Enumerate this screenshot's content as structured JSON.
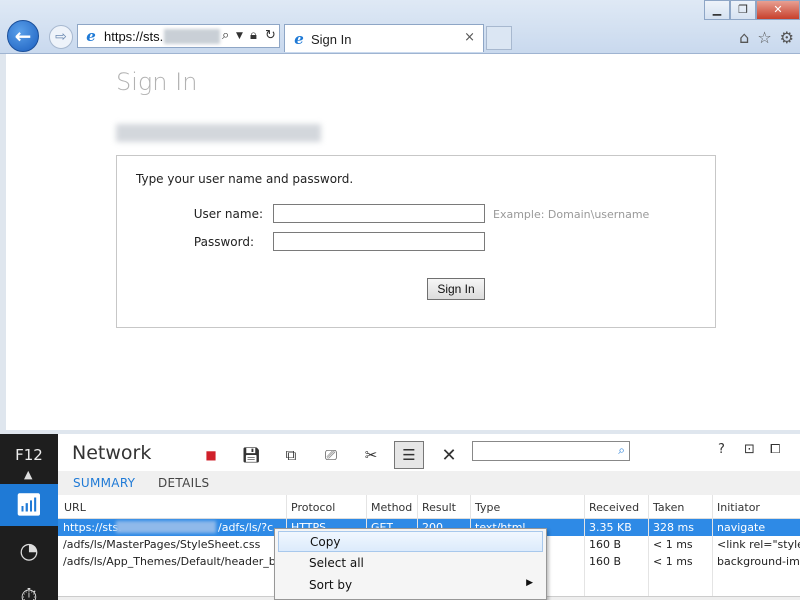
{
  "browser": {
    "address_prefix": "https://sts.",
    "tab_title": "Sign In",
    "tab_close": "×"
  },
  "page": {
    "title": "Sign In",
    "intro": "Type your user name and password.",
    "username_label": "User name:",
    "username_hint": "Example: Domain\\username",
    "password_label": "Password:",
    "signin_button": "Sign In"
  },
  "devtools": {
    "f12_label": "F12",
    "panel_title": "Network",
    "tabs": [
      "SUMMARY",
      "DETAILS"
    ],
    "columns": [
      "URL",
      "Protocol",
      "Method",
      "Result",
      "Type",
      "Received",
      "Taken",
      "Initiator"
    ],
    "rows": [
      {
        "url": "https://sts.",
        "url_tail": "/adfs/ls/?c...",
        "protocol": "HTTPS",
        "method": "GET",
        "result": "200",
        "type": "text/html",
        "received": "3.35 KB",
        "taken": "328 ms",
        "initiator": "navigate"
      },
      {
        "url": "/adfs/ls/MasterPages/StyleSheet.css",
        "url_tail": "",
        "protocol": "",
        "method": "",
        "result": "",
        "type": "",
        "received": "160 B",
        "taken": "< 1 ms",
        "initiator": "<link rel=\"style..."
      },
      {
        "url": "/adfs/ls/App_Themes/Default/header_bac...",
        "url_tail": "",
        "protocol": "",
        "method": "",
        "result": "",
        "type": "",
        "received": "160 B",
        "taken": "< 1 ms",
        "initiator": "background-imag"
      }
    ],
    "help": "?"
  },
  "context_menu": {
    "items": [
      "Copy",
      "Select all",
      "Sort by"
    ]
  },
  "colors": {
    "accent": "#1f7ad6",
    "selection": "#2e8ae6",
    "record": "#d0202a"
  }
}
